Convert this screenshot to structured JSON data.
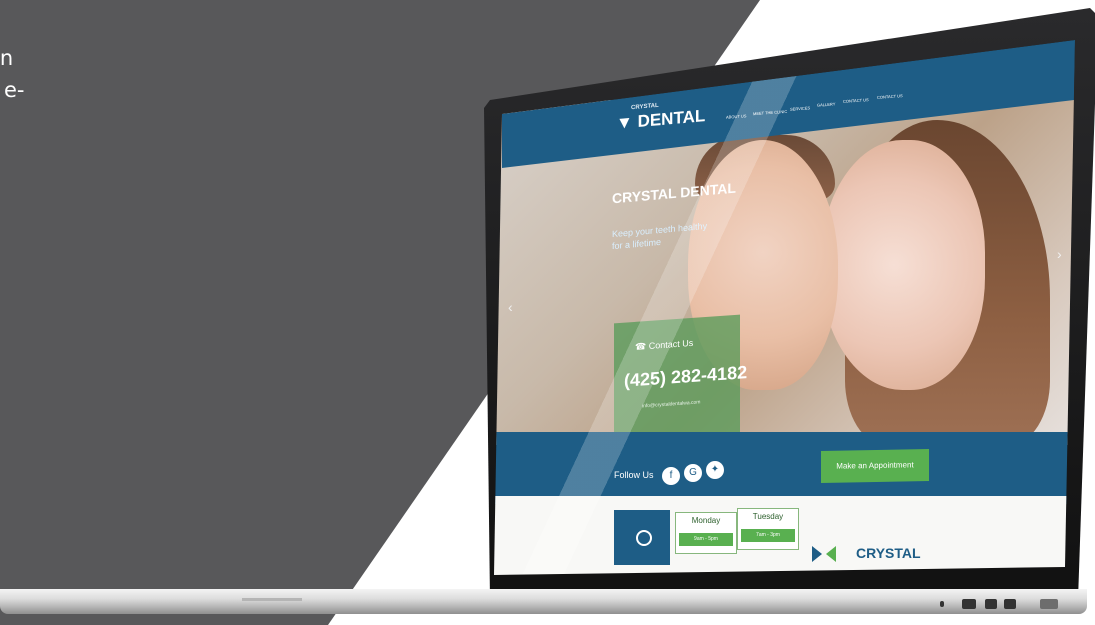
{
  "background": {
    "dark_panel_color": "#58585a",
    "white_color": "#ffffff",
    "left_text_lines": [
      "in",
      "e-"
    ]
  },
  "website": {
    "brand_small": "CRYSTAL",
    "brand_main": "DENTAL",
    "nav_items": [
      "ABOUT US",
      "MEET THE CLINIC",
      "SERVICES",
      "GALLERY",
      "CONTACT US",
      "CONTACT US"
    ],
    "hero_title": "CRYSTAL DENTAL",
    "hero_subtitle_lines": [
      "Keep your teeth healthy",
      "for a lifetime"
    ],
    "contact_label": "Contact Us",
    "phone": "(425) 282-4182",
    "email": "info@crystaldentalwa.com",
    "follow_label": "Follow Us",
    "social_icons": [
      "facebook-icon",
      "google-plus-icon",
      "yelp-icon"
    ],
    "appointment_button": "Make an Appointment",
    "schedule": [
      {
        "day": "Monday",
        "hours": "9am - 5pm"
      },
      {
        "day": "Tuesday",
        "hours": "7am - 3pm"
      }
    ],
    "bottom_brand": "CRYSTAL"
  },
  "colors": {
    "header_blue": "#1e5d86",
    "green_button": "#59b050",
    "contact_green": "#589b5a"
  }
}
